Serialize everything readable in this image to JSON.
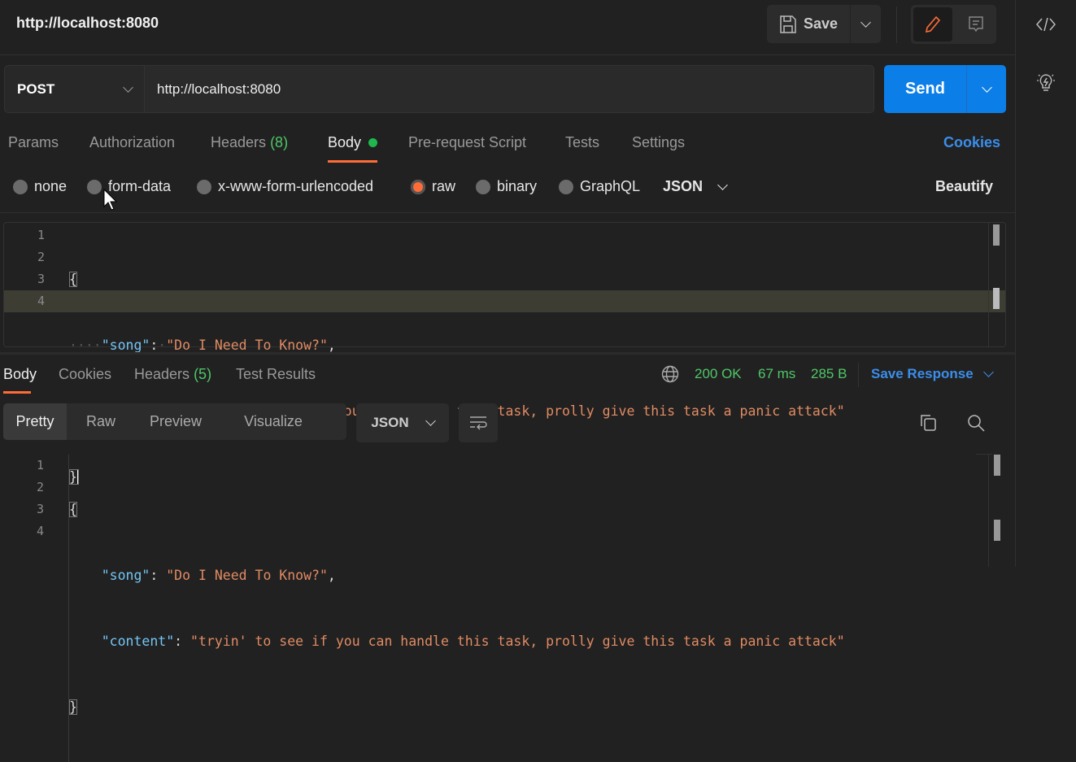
{
  "header": {
    "title": "http://localhost:8080",
    "save_label": "Save",
    "icons": [
      "save-icon",
      "chevron-down-icon",
      "pencil-icon",
      "comment-icon"
    ]
  },
  "sidebar": {
    "icons": [
      "code-icon",
      "lightbulb-icon"
    ]
  },
  "request": {
    "method": "POST",
    "url": "http://localhost:8080",
    "send_label": "Send"
  },
  "request_tabs": [
    {
      "label": "Params"
    },
    {
      "label": "Authorization"
    },
    {
      "label": "Headers",
      "count": "(8)"
    },
    {
      "label": "Body"
    },
    {
      "label": "Pre-request Script"
    },
    {
      "label": "Tests"
    },
    {
      "label": "Settings"
    }
  ],
  "cookies_label": "Cookies",
  "body_types": [
    {
      "label": "none"
    },
    {
      "label": "form-data"
    },
    {
      "label": "x-www-form-urlencoded"
    },
    {
      "label": "raw",
      "selected": true
    },
    {
      "label": "binary"
    },
    {
      "label": "GraphQL"
    }
  ],
  "body_format": "JSON",
  "beautify_label": "Beautify",
  "request_body": {
    "line_numbers": [
      "1",
      "2",
      "3",
      "4"
    ],
    "open": "{",
    "close": "}",
    "key1": "\"song\"",
    "val1": "\"Do I Need To Know?\"",
    "key2": "\"content\"",
    "val2": "\"tryin' to see if you can handle this task, prolly give this task a panic attack\""
  },
  "response_tabs": [
    {
      "label": "Body"
    },
    {
      "label": "Cookies"
    },
    {
      "label": "Headers",
      "count": "(5)"
    },
    {
      "label": "Test Results"
    }
  ],
  "response_status": {
    "status": "200 OK",
    "time": "67 ms",
    "size": "285 B",
    "save_label": "Save Response"
  },
  "view_modes": [
    "Pretty",
    "Raw",
    "Preview",
    "Visualize"
  ],
  "response_format": "JSON",
  "colors": {
    "accent": "#ff6c37",
    "send": "#0c7ee8",
    "link": "#3b8eea",
    "success": "#4fc767"
  }
}
